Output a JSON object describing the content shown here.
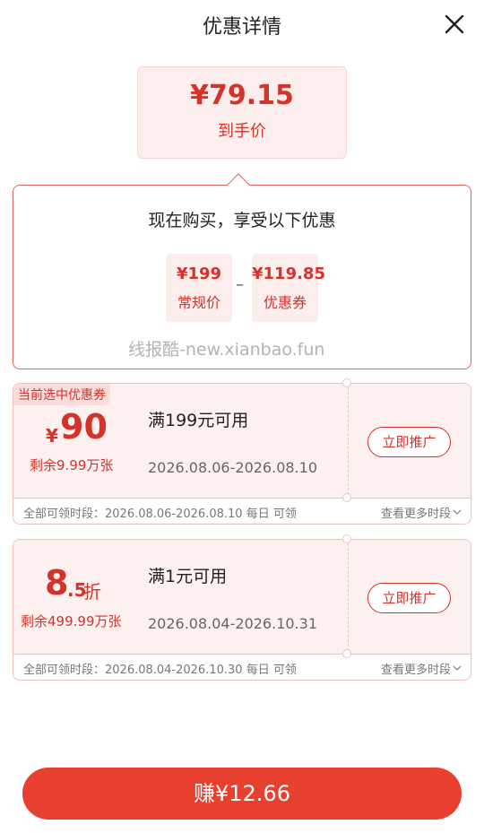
{
  "header": {
    "title": "优惠详情"
  },
  "final": {
    "price": "¥79.15",
    "label": "到手价"
  },
  "summary": {
    "title": "现在购买，享受以下优惠",
    "original_value": "¥199",
    "original_label": "常规价",
    "minus": "–",
    "coupon_value": "¥119.85",
    "coupon_label": "优惠券"
  },
  "watermark": "线报酷-new.xianbao.fun",
  "coupons": [
    {
      "tag": "当前选中优惠券",
      "symbol": "¥",
      "amount": "90",
      "remain": "剩余9.99万张",
      "condition": "满199元可用",
      "valid": "2026.08.06-2026.08.10",
      "action": "立即推广",
      "time_range": "全部可领时段：2026.08.06-2026.08.10 每日 可领",
      "more": "查看更多时段"
    },
    {
      "amount_main": "8",
      "amount_decimal": ".5",
      "amount_unit": "折",
      "remain": "剩余499.99万张",
      "condition": "满1元可用",
      "valid": "2026.08.04-2026.10.31",
      "action": "立即推广",
      "time_range": "全部可领时段：2026.08.04-2026.10.30 每日 可领",
      "more": "查看更多时段"
    }
  ],
  "footer": {
    "earn_label": "赚¥12.66"
  },
  "colors": {
    "accent": "#d5322a",
    "button": "#e8402f",
    "coupon_bg": "#fdf1f0"
  }
}
